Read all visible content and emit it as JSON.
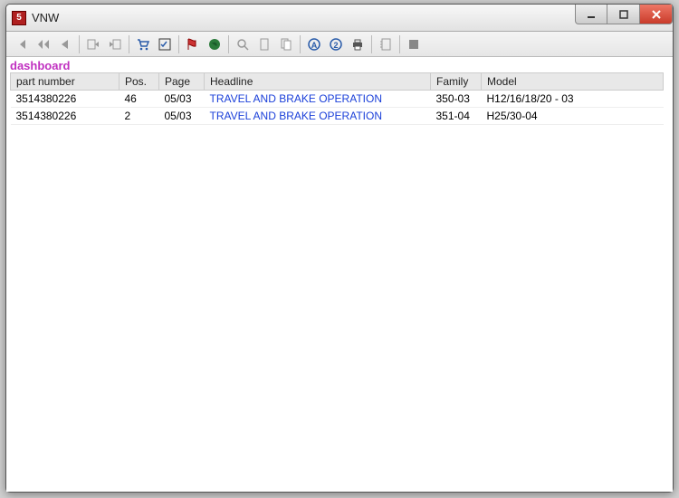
{
  "window": {
    "title": "VNW"
  },
  "section_label": "dashboard",
  "columns": {
    "part_number": "part number",
    "pos": "Pos.",
    "page": "Page",
    "headline": "Headline",
    "family": "Family",
    "model": "Model"
  },
  "rows": [
    {
      "part_number": "3514380226",
      "pos": "46",
      "page": "05/03",
      "headline": "TRAVEL AND BRAKE OPERATION",
      "family": "350-03",
      "model": "H12/16/18/20 - 03"
    },
    {
      "part_number": "3514380226",
      "pos": "2",
      "page": "05/03",
      "headline": "TRAVEL AND BRAKE OPERATION",
      "family": "351-04",
      "model": "H25/30-04"
    }
  ],
  "toolbar_icons": [
    "nav-first-icon",
    "nav-prev-fast-icon",
    "nav-prev-icon",
    "sep",
    "export-out-icon",
    "export-in-icon",
    "sep",
    "cart-icon",
    "checklist-icon",
    "sep",
    "flag-icon",
    "globe-icon",
    "sep",
    "zoom-icon",
    "page-icon",
    "page2-icon",
    "sep",
    "bold-a-icon",
    "circled-2-icon",
    "print-icon",
    "sep",
    "notebook-icon",
    "sep",
    "stop-icon"
  ]
}
